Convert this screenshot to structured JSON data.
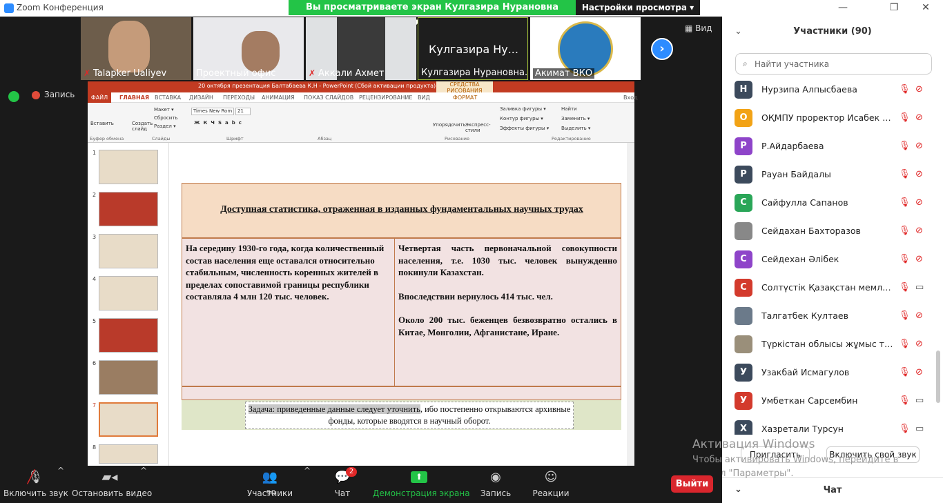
{
  "window": {
    "title": "Zoom Конференция"
  },
  "banner": {
    "text": "Вы просматриваете экран Кулгазира Нурановна Балтабаева",
    "view_settings": "Настройки просмотра ▾"
  },
  "thumbs": [
    {
      "name": "Talapker Ualiyev",
      "muted": true
    },
    {
      "name": "Проектный офис",
      "muted": false
    },
    {
      "name": "Аккали Ахмет",
      "muted": true
    },
    {
      "name": "Кулгазира Нурановна...",
      "big": "Кулгазира Ну...",
      "muted": false
    },
    {
      "name": "Акимат ВКО",
      "muted": false
    }
  ],
  "view_btn": "Вид",
  "record_label": "Запись",
  "ppt": {
    "title": "20 октября презентация Балтабаева К.Н - PowerPoint (Сбой активации продукта)",
    "drawing_tools": "СРЕДСТВА РИСОВАНИЯ",
    "tabs": [
      "ФАЙЛ",
      "ГЛАВНАЯ",
      "ВСТАВКА",
      "ДИЗАЙН",
      "ПЕРЕХОДЫ",
      "АНИМАЦИЯ",
      "ПОКАЗ СЛАЙДОВ",
      "РЕЦЕНЗИРОВАНИЕ",
      "ВИД",
      "ФОРМАТ"
    ],
    "login": "Вход",
    "ribbon": {
      "paste": "Вставить",
      "create_slide": "Создать слайд",
      "layout": "Макет ▾",
      "reset": "Сбросить",
      "section": "Раздел ▾",
      "font": "Times New Rom",
      "size": "21",
      "arrange": "Упорядочить",
      "quick_styles": "Экспресс-стили",
      "fill": "Заливка фигуры ▾",
      "outline": "Контур фигуры ▾",
      "effects": "Эффекты фигуры ▾",
      "find": "Найти",
      "replace": "Заменить ▾",
      "select": "Выделить ▾",
      "groups": [
        "Буфер обмена",
        "Слайды",
        "Шрифт",
        "Абзац",
        "Рисование",
        "Редактирование"
      ]
    },
    "slide_numbers": [
      "1",
      "2",
      "3",
      "4",
      "5",
      "6",
      "7",
      "8"
    ],
    "slide_title": "Доступная статистика, отраженная  в изданных фундаментальных научных трудах",
    "left_cell": "На середину 1930-го года, когда количественный состав населения еще оставался относительно стабильным, численность коренных жителей в пределах сопоставимой границы республики составляла 4 млн 120 тыс. человек.",
    "right_cell_1": "Четвертая часть первоначальной совокупности населения, т.е. 1030 тыс. человек вынужденно покинули Казахстан.",
    "right_cell_2": "Впоследствии вернулось 414 тыс. чел.",
    "right_cell_3": "Около 200 тыс. беженцев безвозвратно остались в Китае, Монголии, Афганистане, Иране.",
    "task_highlight": "Задача: приведенные данные следует уточнить",
    "task_rest": ", ибо постепенно открываются архивные фонды, которые вводятся в научный оборот."
  },
  "participants": {
    "title": "Участники (90)",
    "search_placeholder": "Найти участника",
    "list": [
      {
        "initial": "Н",
        "color": "#3c4a5c",
        "name": "Нурзипа Алпысбаева",
        "cam_on": false
      },
      {
        "initial": "О",
        "color": "#f2a316",
        "name": "ОҚМПУ проректор Исабек Бар...",
        "cam_on": false
      },
      {
        "initial": "Р",
        "color": "#8e44c9",
        "name": "Р.Айдарбаева",
        "cam_on": false
      },
      {
        "initial": "Р",
        "color": "#3c4a5c",
        "name": "Рауан Байдалы",
        "cam_on": false
      },
      {
        "initial": "С",
        "color": "#2aa658",
        "name": "Сайфулла Сапанов",
        "cam_on": false
      },
      {
        "initial": "",
        "color": "#888888",
        "name": "Сейдахан Бахторазов",
        "cam_on": false
      },
      {
        "initial": "С",
        "color": "#8e44c9",
        "name": "Сейдехан Әлібек",
        "cam_on": false
      },
      {
        "initial": "С",
        "color": "#d33a2c",
        "name": "Солтүстік Қазақстан мемлекет...",
        "cam_on": true
      },
      {
        "initial": "",
        "color": "#6b7a8a",
        "name": "Талгатбек Култаев",
        "cam_on": false
      },
      {
        "initial": "",
        "color": "#9a8f7a",
        "name": "Түркістан облысы жұмыс тобы",
        "cam_on": false
      },
      {
        "initial": "У",
        "color": "#3c4a5c",
        "name": "Узакбай Исмагулов",
        "cam_on": false
      },
      {
        "initial": "У",
        "color": "#d33a2c",
        "name": "Умбеткан Сарсембин",
        "cam_on": true
      },
      {
        "initial": "Х",
        "color": "#3c4a5c",
        "name": "Хазретали Турсун",
        "cam_on": true
      }
    ],
    "invite": "Пригласить",
    "unmute": "Включить свой звук"
  },
  "activation": {
    "title": "Активация Windows",
    "line1": "Чтобы активировать Windows, перейдите в",
    "line2": "раздел \"Параметры\"."
  },
  "chat_title": "Чат",
  "toolbar": {
    "audio": "Включить звук",
    "video": "Остановить видео",
    "participants_count": "90",
    "participants": "Участники",
    "chat": "Чат",
    "chat_badge": "2",
    "share": "Демонстрация экрана",
    "record": "Запись",
    "reactions": "Реакции",
    "leave": "Выйти"
  }
}
